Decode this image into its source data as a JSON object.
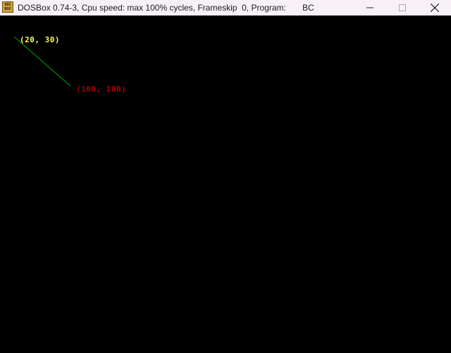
{
  "window": {
    "icon_text_line1": "DOS",
    "icon_text_line2": "BOX",
    "title": "DOSBox 0.74-3, Cpu speed: max 100% cycles, Frameskip  0, Program:       BC"
  },
  "screen": {
    "background": "#000000",
    "line_color": "#00aa00",
    "start_label": "(20, 30)",
    "start_label_color": "#ffff55",
    "end_label": "(100, 100)",
    "end_label_color": "#aa0000"
  },
  "icons": {
    "minimize": "minimize-icon",
    "maximize": "maximize-icon",
    "close": "close-icon"
  }
}
